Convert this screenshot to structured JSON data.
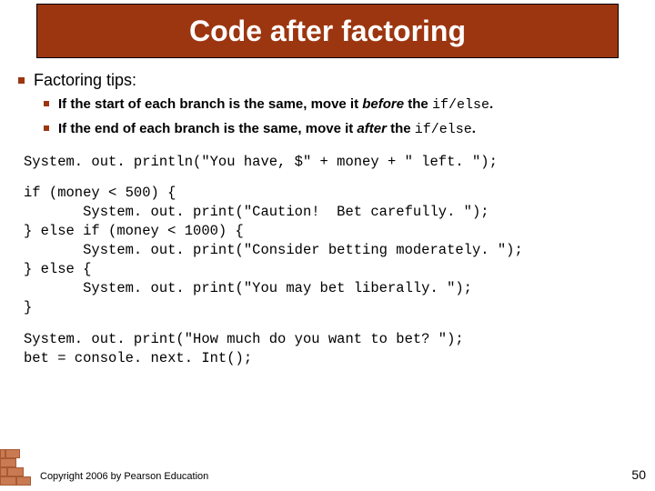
{
  "title": "Code after factoring",
  "heading": "Factoring tips:",
  "tips": [
    {
      "prefix": "If the start of each branch is the same, move it ",
      "emph": "before",
      "mid": " the ",
      "code": "if/else",
      "suffix": "."
    },
    {
      "prefix": "If the end of each branch is the same, move it ",
      "emph": "after",
      "mid": " the ",
      "code": "if/else",
      "suffix": "."
    }
  ],
  "code1": "System. out. println(\"You have, $\" + money + \" left. \");",
  "code2": "if (money < 500) {\n       System. out. print(\"Caution!  Bet carefully. \");\n} else if (money < 1000) {\n       System. out. print(\"Consider betting moderately. \");\n} else {\n       System. out. print(\"You may bet liberally. \");\n}",
  "code3": "System. out. print(\"How much do you want to bet? \");\nbet = console. next. Int();",
  "copyright": "Copyright 2006 by Pearson Education",
  "page_number": "50"
}
